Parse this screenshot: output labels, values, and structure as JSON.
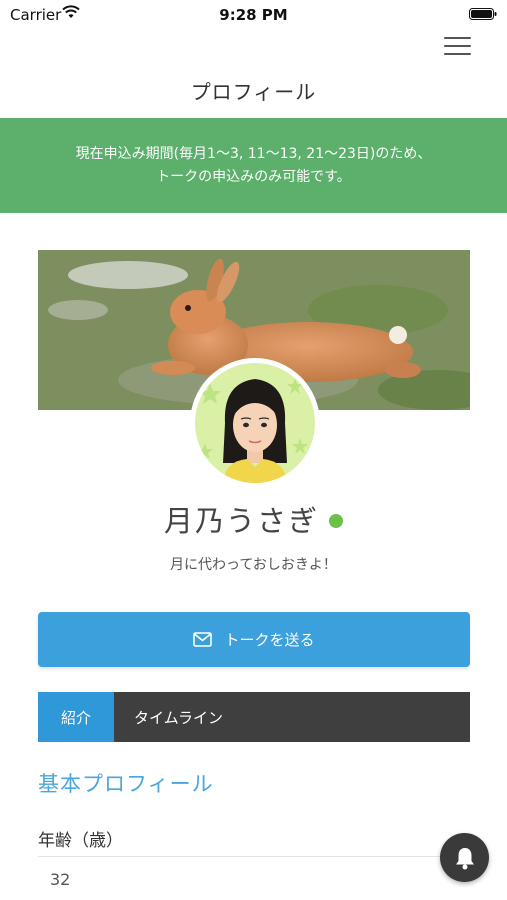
{
  "status_bar": {
    "carrier": "Carrier",
    "time": "9:28 PM"
  },
  "header": {
    "title": "プロフィール",
    "menu_icon": "hamburger-menu-icon"
  },
  "notice": {
    "line1": "現在申込み期間(毎月1〜3, 11〜13, 21〜23日)のため、",
    "line2": "トークの申込みのみ可能です。",
    "background_color": "#5cb06c"
  },
  "profile": {
    "name": "月乃うさぎ",
    "online_status_color": "#6cc04a",
    "tagline": "月に代わっておしおきよ！"
  },
  "actions": {
    "talk_button_label": "トークを送る",
    "talk_button_icon": "mail-icon",
    "talk_button_color": "#3ba0dc"
  },
  "tabs": [
    {
      "label": "紹介",
      "active": true
    },
    {
      "label": "タイムライン",
      "active": false
    }
  ],
  "basic_profile": {
    "section_title": "基本プロフィール",
    "fields": [
      {
        "label": "年齢（歳）",
        "value": "32"
      }
    ]
  },
  "fab": {
    "icon": "bell-icon"
  }
}
